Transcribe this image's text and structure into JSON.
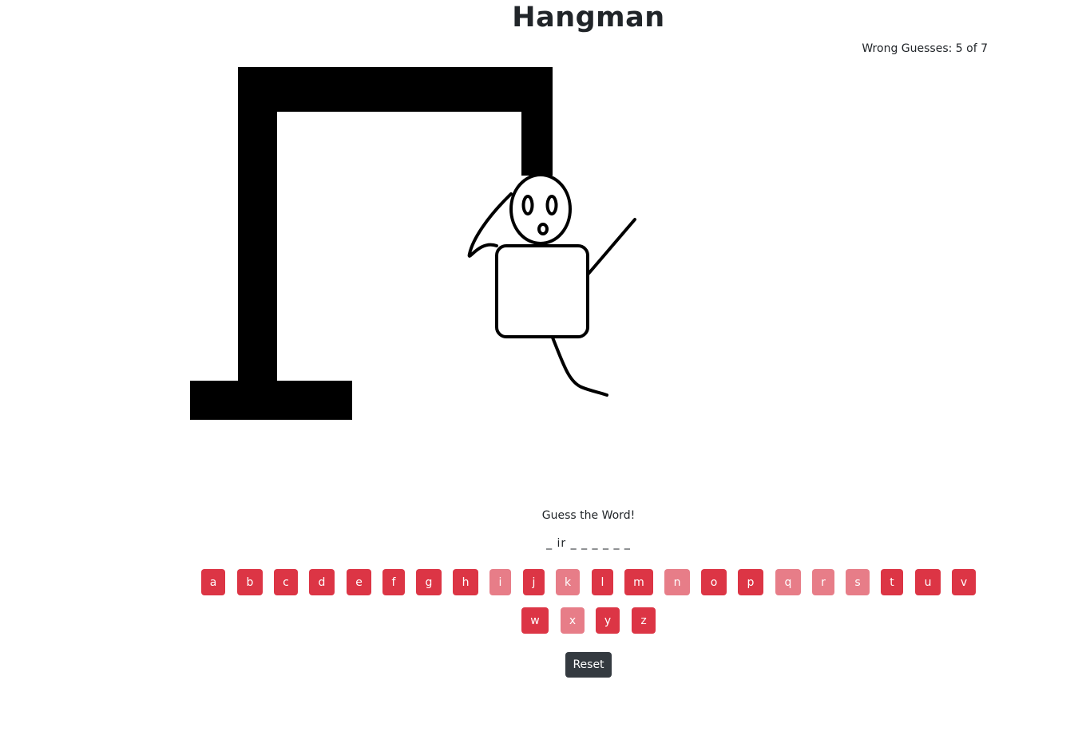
{
  "title": "Hangman",
  "status": {
    "wrong_label": "Wrong Guesses: 5 of 7",
    "wrong_count": 5,
    "max_wrong": 7
  },
  "prompt": "Guess the Word!",
  "word_display": "_ ir _ _ _ _ _ _",
  "letters": [
    {
      "letter": "a",
      "state": "available"
    },
    {
      "letter": "b",
      "state": "available"
    },
    {
      "letter": "c",
      "state": "available"
    },
    {
      "letter": "d",
      "state": "available"
    },
    {
      "letter": "e",
      "state": "available"
    },
    {
      "letter": "f",
      "state": "available"
    },
    {
      "letter": "g",
      "state": "available"
    },
    {
      "letter": "h",
      "state": "available"
    },
    {
      "letter": "i",
      "state": "used"
    },
    {
      "letter": "j",
      "state": "available"
    },
    {
      "letter": "k",
      "state": "used"
    },
    {
      "letter": "l",
      "state": "available"
    },
    {
      "letter": "m",
      "state": "available"
    },
    {
      "letter": "n",
      "state": "used"
    },
    {
      "letter": "o",
      "state": "available"
    },
    {
      "letter": "p",
      "state": "available"
    },
    {
      "letter": "q",
      "state": "used"
    },
    {
      "letter": "r",
      "state": "used"
    },
    {
      "letter": "s",
      "state": "used"
    },
    {
      "letter": "t",
      "state": "available"
    },
    {
      "letter": "u",
      "state": "available"
    },
    {
      "letter": "v",
      "state": "available"
    },
    {
      "letter": "w",
      "state": "available"
    },
    {
      "letter": "x",
      "state": "used"
    },
    {
      "letter": "y",
      "state": "available"
    },
    {
      "letter": "z",
      "state": "available"
    }
  ],
  "reset_label": "Reset",
  "colors": {
    "key_available": "#dc3545",
    "key_used": "#e77d88",
    "reset_bg": "#343a40",
    "gallows": "#000000"
  }
}
